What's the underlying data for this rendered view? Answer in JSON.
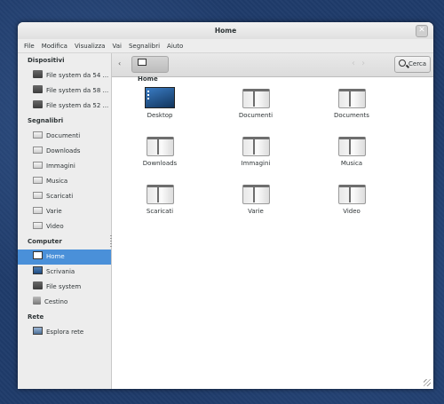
{
  "window": {
    "title": "Home",
    "close_glyph": "✕"
  },
  "menu": [
    "File",
    "Modifica",
    "Visualizza",
    "Vai",
    "Segnalibri",
    "Aiuto"
  ],
  "sidebar": {
    "sections": [
      {
        "title": "Dispositivi",
        "items": [
          {
            "label": "File system da 54 ...",
            "icon": "drive-icon"
          },
          {
            "label": "File system da 58 ...",
            "icon": "drive-icon"
          },
          {
            "label": "File system da 52 ...",
            "icon": "drive-icon"
          }
        ]
      },
      {
        "title": "Segnalibri",
        "items": [
          {
            "label": "Documenti",
            "icon": "folder-icon"
          },
          {
            "label": "Downloads",
            "icon": "folder-icon"
          },
          {
            "label": "Immagini",
            "icon": "folder-icon"
          },
          {
            "label": "Musica",
            "icon": "folder-icon"
          },
          {
            "label": "Scaricati",
            "icon": "folder-icon"
          },
          {
            "label": "Varie",
            "icon": "folder-icon"
          },
          {
            "label": "Video",
            "icon": "folder-icon"
          }
        ]
      },
      {
        "title": "Computer",
        "items": [
          {
            "label": "Home",
            "icon": "home-icon",
            "active": true
          },
          {
            "label": "Scrivania",
            "icon": "desktop-icon"
          },
          {
            "label": "File system",
            "icon": "drive-icon"
          },
          {
            "label": "Cestino",
            "icon": "trash-icon"
          }
        ]
      },
      {
        "title": "Rete",
        "items": [
          {
            "label": "Esplora rete",
            "icon": "network-icon"
          }
        ]
      }
    ]
  },
  "toolbar": {
    "path_label": "Home",
    "search_label": "Cerca",
    "back_glyph": "‹",
    "nav_glyphs": "‹ ›"
  },
  "files": [
    {
      "label": "Desktop",
      "icon": "desktop-icon"
    },
    {
      "label": "Documenti",
      "icon": "folder-icon"
    },
    {
      "label": "Documents",
      "icon": "folder-icon"
    },
    {
      "label": "Downloads",
      "icon": "folder-icon"
    },
    {
      "label": "Immagini",
      "icon": "folder-icon"
    },
    {
      "label": "Musica",
      "icon": "folder-icon"
    },
    {
      "label": "Scaricati",
      "icon": "folder-icon"
    },
    {
      "label": "Varie",
      "icon": "folder-icon"
    },
    {
      "label": "Video",
      "icon": "folder-icon"
    }
  ],
  "colors": {
    "accent": "#4a90d9",
    "desktop_bg": "#1f3b6a"
  }
}
